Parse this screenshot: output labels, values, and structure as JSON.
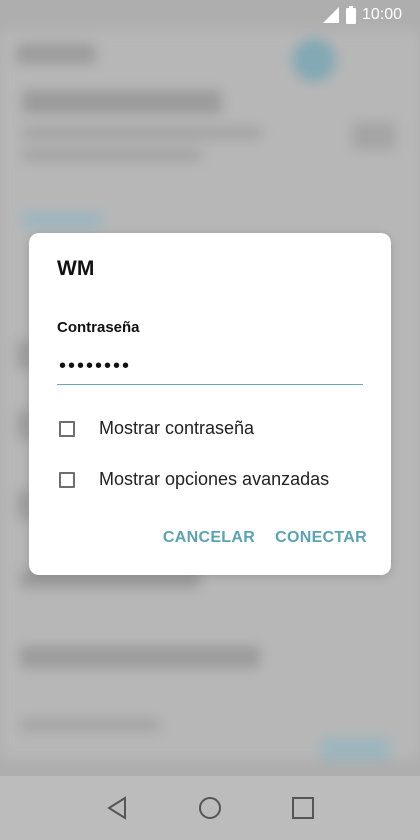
{
  "status_bar": {
    "time": "10:00",
    "icons": [
      "signal-icon",
      "battery-icon"
    ]
  },
  "dialog": {
    "title": "WM",
    "password_label": "Contraseña",
    "password_value": "••••••••",
    "options": [
      {
        "label": "Mostrar contraseña",
        "checked": false
      },
      {
        "label": "Mostrar opciones avanzadas",
        "checked": false
      }
    ],
    "cancel_label": "CANCELAR",
    "connect_label": "CONECTAR"
  },
  "nav": {
    "icons": [
      "back-icon",
      "home-icon",
      "recents-icon"
    ]
  },
  "colors": {
    "accent": "#5aa3b5",
    "underline": "#6aa8b8",
    "dialog_bg": "#ffffff",
    "background": "#bdbdbd"
  }
}
